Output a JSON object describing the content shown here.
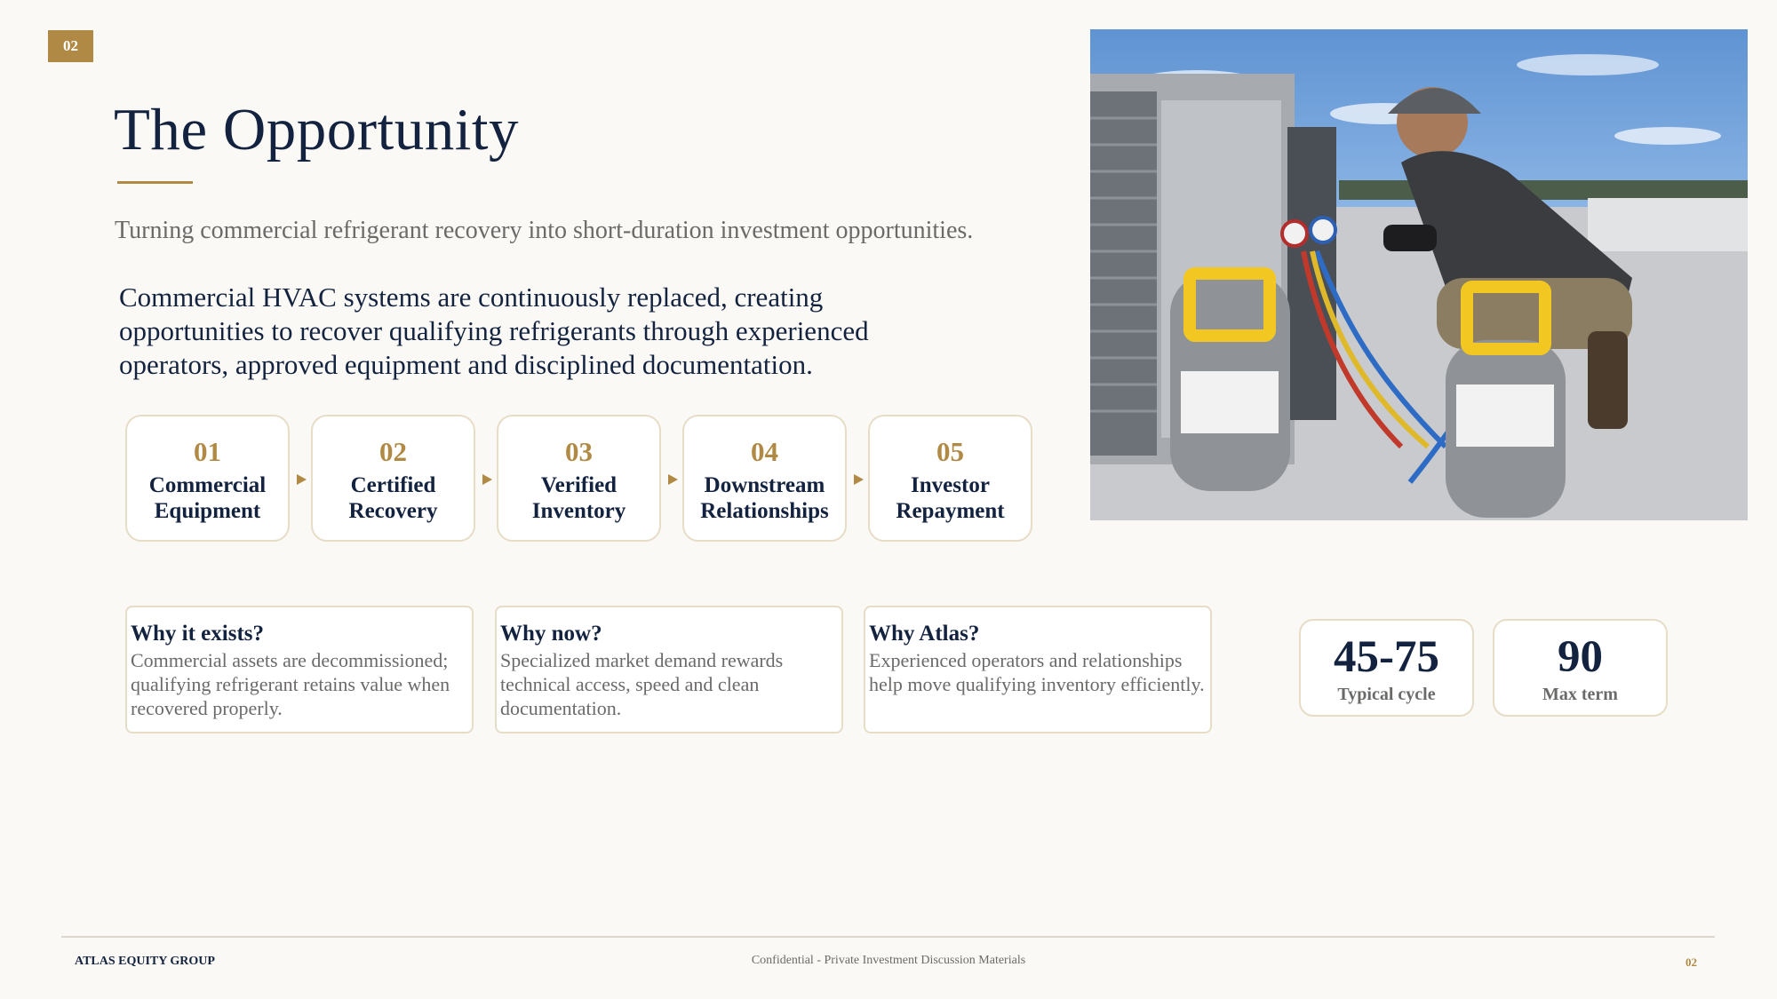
{
  "page_number": "02",
  "title": "The Opportunity",
  "subtitle": "Turning commercial refrigerant recovery into short-duration investment opportunities.",
  "lead": "Commercial HVAC systems are continuously replaced, creating opportunities to recover qualifying refrigerants through experienced operators, approved equipment and disciplined documentation.",
  "steps": [
    {
      "num": "01",
      "label": "Commercial\nEquipment"
    },
    {
      "num": "02",
      "label": "Certified\nRecovery"
    },
    {
      "num": "03",
      "label": "Verified\nInventory"
    },
    {
      "num": "04",
      "label": "Downstream\nRelationships"
    },
    {
      "num": "05",
      "label": "Investor\nRepayment"
    }
  ],
  "cards": [
    {
      "title": "Why it exists?",
      "body": "Commercial assets are decommissioned; qualifying refrigerant retains value when recovered properly."
    },
    {
      "title": "Why now?",
      "body": "Specialized market demand rewards technical access, speed and clean documentation."
    },
    {
      "title": "Why Atlas?",
      "body": "Experienced operators and relationships help move qualifying inventory efficiently."
    }
  ],
  "stats": [
    {
      "value": "45-75",
      "label": "Typical cycle"
    },
    {
      "value": "90",
      "label": "Max term"
    }
  ],
  "footer": {
    "brand": "ATLAS EQUITY GROUP",
    "note": "Confidential - Private Investment Discussion Materials",
    "page": "02"
  },
  "colors": {
    "navy": "#13233f",
    "gold": "#b08a45",
    "gray_text": "#6c6a69",
    "border": "#e7dcc6"
  }
}
